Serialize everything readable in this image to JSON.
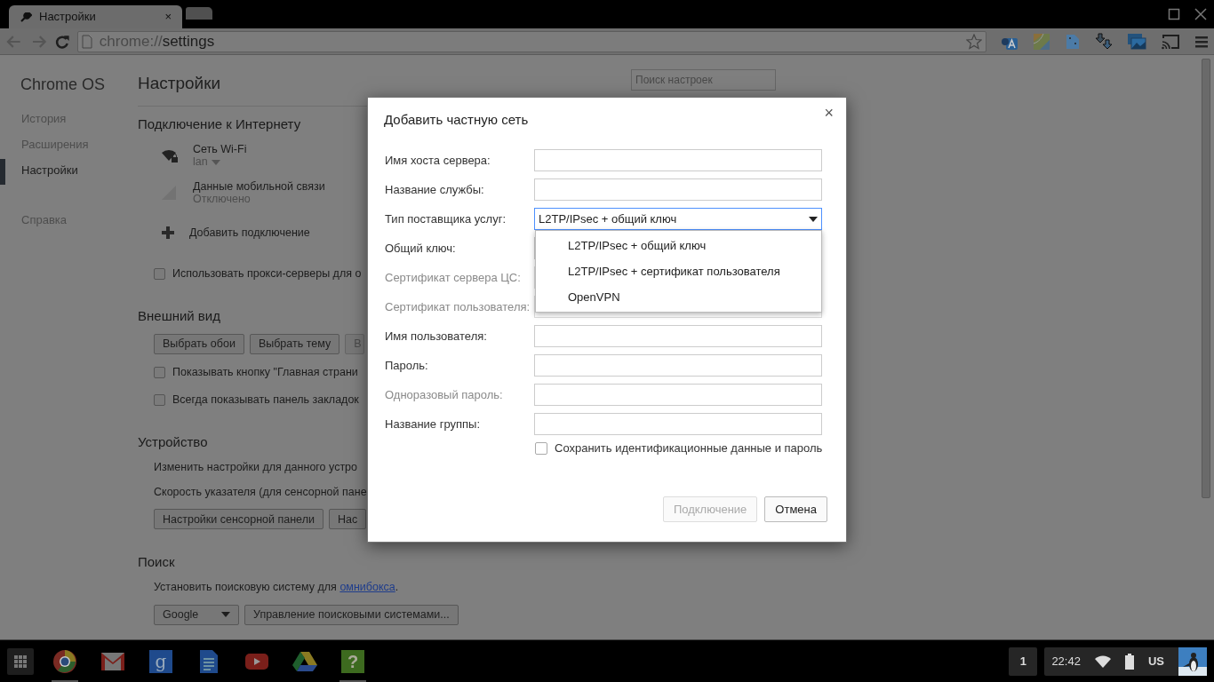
{
  "browser": {
    "tabs": [
      {
        "title": "Настройки",
        "close": "×",
        "selected": true
      }
    ],
    "address": {
      "scheme": "chrome://",
      "path": "settings"
    }
  },
  "sidebar": {
    "title": "Chrome OS",
    "items": [
      {
        "label": "История",
        "selected": false
      },
      {
        "label": "Расширения",
        "selected": false
      },
      {
        "label": "Настройки",
        "selected": true
      },
      {
        "label": "Справка",
        "selected": false
      }
    ]
  },
  "page": {
    "title": "Настройки",
    "search": {
      "placeholder": "Поиск настроек"
    },
    "sections": [
      {
        "heading": "Подключение к Интернету",
        "items": [
          {
            "kind": "wifi",
            "name": "Сеть Wi-Fi",
            "status": "lan",
            "menu": true
          },
          {
            "kind": "mobile",
            "name": "Данные мобильной связи",
            "status": "Отключено",
            "menu": false
          },
          {
            "kind": "action",
            "label": "Добавить подключение"
          },
          {
            "kind": "checkbox",
            "label": "Использовать прокси-серверы для о",
            "checked": false
          }
        ]
      },
      {
        "heading": "Внешний вид",
        "items": [
          {
            "kind": "buttons",
            "buttons": [
              {
                "label": "Выбрать обои",
                "disabled": false
              },
              {
                "label": "Выбрать тему",
                "disabled": false
              },
              {
                "label": "В",
                "disabled": true
              }
            ]
          },
          {
            "kind": "checkbox",
            "label": "Показывать кнопку \"Главная страни",
            "checked": false
          },
          {
            "kind": "checkbox",
            "label": "Всегда показывать панель закладок",
            "checked": false
          }
        ]
      },
      {
        "heading": "Устройство",
        "items": [
          {
            "kind": "text",
            "text": "Изменить настройки для данного устро"
          },
          {
            "kind": "text",
            "text": "Скорость указателя (для сенсорной пане"
          },
          {
            "kind": "buttons",
            "buttons": [
              {
                "label": "Настройки сенсорной панели",
                "disabled": false
              },
              {
                "label": "Нас",
                "disabled": false
              }
            ]
          }
        ]
      },
      {
        "heading": "Поиск",
        "items": [
          {
            "kind": "text",
            "text": "Установить поисковую систему для ",
            "link": "омнибокса",
            "after": "."
          },
          {
            "kind": "select",
            "value": "Google",
            "buttons": [
              {
                "label": "Управление поисковыми системами...",
                "disabled": false
              }
            ]
          }
        ]
      }
    ]
  },
  "dialog": {
    "title": "Добавить частную сеть",
    "close": "×",
    "rows": [
      {
        "label": "Имя хоста сервера:",
        "kind": "text",
        "disabled": false
      },
      {
        "label": "Название службы:",
        "kind": "text",
        "disabled": false
      },
      {
        "label": "Тип поставщика услуг:",
        "kind": "select",
        "disabled": false,
        "value": "L2TP/IPsec + общий ключ",
        "expanded": true,
        "options": [
          "L2TP/IPsec + общий ключ",
          "L2TP/IPsec + сертификат пользователя",
          "OpenVPN"
        ]
      },
      {
        "label": "Общий ключ:",
        "kind": "password",
        "disabled": false
      },
      {
        "label": "Сертификат сервера ЦС:",
        "kind": "select",
        "disabled": true
      },
      {
        "label": "Сертификат пользователя:",
        "kind": "select",
        "disabled": true
      },
      {
        "label": "Имя пользователя:",
        "kind": "text",
        "disabled": false
      },
      {
        "label": "Пароль:",
        "kind": "password",
        "disabled": false
      },
      {
        "label": "Одноразовый пароль:",
        "kind": "text",
        "disabled": true
      },
      {
        "label": "Название группы:",
        "kind": "text",
        "disabled": false
      }
    ],
    "save": {
      "label": "Сохранить идентификационные данные и пароль",
      "checked": false
    },
    "buttons": [
      {
        "label": "Подключение",
        "disabled": true
      },
      {
        "label": "Отмена",
        "disabled": false
      }
    ]
  },
  "taskbar": {
    "apps": [
      {
        "kind": "browser",
        "running": true
      },
      {
        "kind": "mail",
        "running": false
      },
      {
        "kind": "search",
        "glyph": "g",
        "running": false
      },
      {
        "kind": "docs",
        "running": false
      },
      {
        "kind": "video",
        "running": false
      },
      {
        "kind": "drive",
        "running": false
      },
      {
        "kind": "help",
        "glyph": "?",
        "running": true
      }
    ],
    "windows": "1",
    "time": "22:42",
    "layout": "US"
  }
}
